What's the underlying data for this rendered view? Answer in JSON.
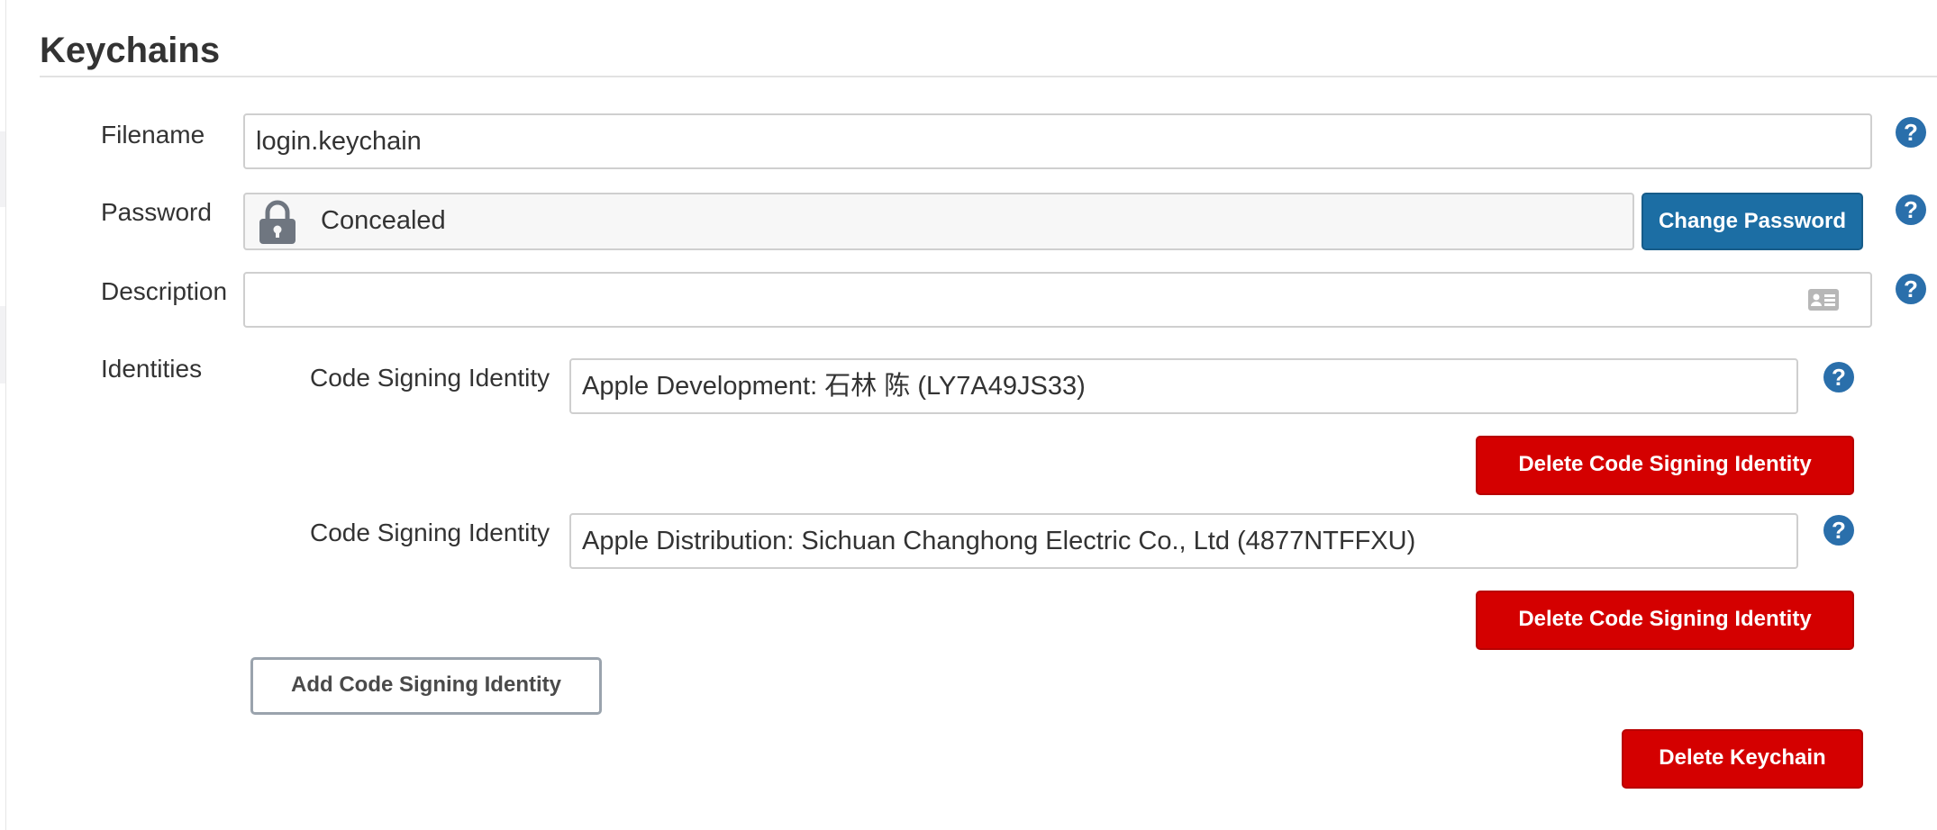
{
  "section": {
    "title": "Keychains"
  },
  "filename": {
    "label": "Filename",
    "value": "login.keychain",
    "help_icon": "help-circle-icon"
  },
  "password": {
    "label": "Password",
    "value": "Concealed",
    "lock_icon": "lock-icon",
    "change_button": "Change Password",
    "help_icon": "help-circle-icon"
  },
  "description": {
    "label": "Description",
    "value": "",
    "card_icon": "id-card-icon",
    "help_icon": "help-circle-icon"
  },
  "identities": {
    "label": "Identities",
    "items": [
      {
        "label": "Code Signing Identity",
        "value": "Apple Development: 石林 陈 (LY7A49JS33)",
        "delete_button": "Delete Code Signing Identity"
      },
      {
        "label": "Code Signing Identity",
        "value": "Apple Distribution: Sichuan Changhong Electric Co., Ltd (4877NTFFXU)",
        "delete_button": "Delete Code Signing Identity"
      }
    ],
    "add_button": "Add Code Signing Identity"
  },
  "delete_keychain_button": "Delete Keychain",
  "help_glyph": "?",
  "colors": {
    "primary": "#1c6ea4",
    "danger": "#d40000",
    "help": "#2a6fab"
  }
}
